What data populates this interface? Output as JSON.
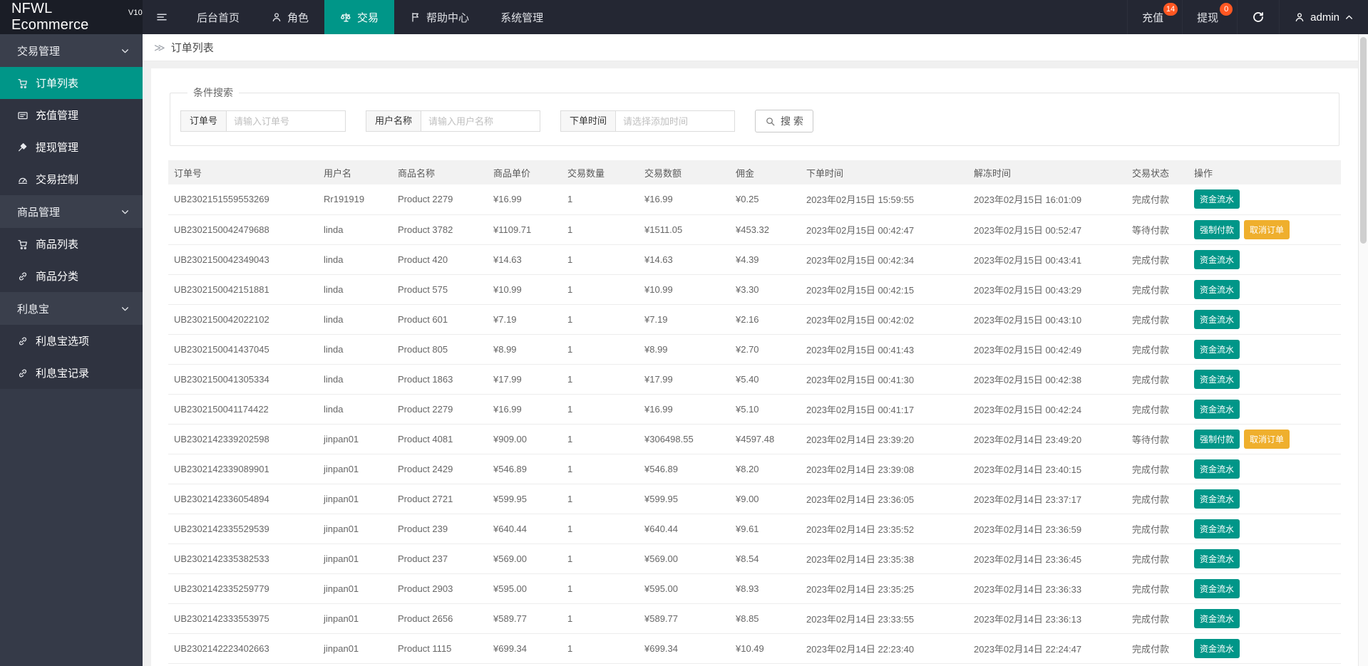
{
  "brand": {
    "name": "NFWL Ecommerce",
    "version": "V10"
  },
  "topnav": {
    "menu": [
      {
        "key": "dashboard",
        "label": "后台首页",
        "icon": "",
        "active": false
      },
      {
        "key": "roles",
        "label": "角色",
        "icon": "user",
        "active": false
      },
      {
        "key": "trade",
        "label": "交易",
        "icon": "scale",
        "active": true
      },
      {
        "key": "help-center",
        "label": "帮助中心",
        "icon": "flag",
        "active": false
      },
      {
        "key": "system",
        "label": "系统管理",
        "icon": "",
        "active": false
      }
    ],
    "quick": [
      {
        "key": "recharge",
        "label": "充值",
        "badge": "14"
      },
      {
        "key": "withdraw",
        "label": "提现",
        "badge": "0"
      }
    ],
    "user": {
      "name": "admin"
    }
  },
  "sidebar": {
    "groups": [
      {
        "key": "trade-management",
        "label": "交易管理",
        "items": [
          {
            "key": "order-list",
            "label": "订单列表",
            "icon": "cart",
            "active": true
          },
          {
            "key": "recharge-management",
            "label": "充值管理",
            "icon": "card",
            "active": false
          },
          {
            "key": "withdraw-management",
            "label": "提现管理",
            "icon": "gavel",
            "active": false
          },
          {
            "key": "trade-control",
            "label": "交易控制",
            "icon": "gauge",
            "active": false
          }
        ]
      },
      {
        "key": "product-management",
        "label": "商品管理",
        "items": [
          {
            "key": "product-list",
            "label": "商品列表",
            "icon": "cart",
            "active": false
          },
          {
            "key": "product-category",
            "label": "商品分类",
            "icon": "link",
            "active": false
          }
        ]
      },
      {
        "key": "interest-treasure",
        "label": "利息宝",
        "items": [
          {
            "key": "interest-options",
            "label": "利息宝选项",
            "icon": "link",
            "active": false
          },
          {
            "key": "interest-records",
            "label": "利息宝记录",
            "icon": "link",
            "active": false
          }
        ]
      }
    ]
  },
  "breadcrumb": {
    "title": "订单列表"
  },
  "search": {
    "legend": "条件搜索",
    "fields": [
      {
        "label": "订单号",
        "placeholder": "请输入订单号"
      },
      {
        "label": "用户名称",
        "placeholder": "请输入用户名称"
      },
      {
        "label": "下单时间",
        "placeholder": "请选择添加时间"
      }
    ],
    "button_label": "搜 索"
  },
  "table": {
    "headers": [
      "订单号",
      "用户名",
      "商品名称",
      "商品单价",
      "交易数量",
      "交易数额",
      "佣金",
      "下单时间",
      "解冻时间",
      "交易状态",
      "操作"
    ],
    "action_sets": {
      "flow": [
        {
          "label": "资金流水",
          "name": "fund-flow-button",
          "style": "teal"
        }
      ],
      "force": [
        {
          "label": "强制付款",
          "name": "force-pay-button",
          "style": "teal"
        },
        {
          "label": "取消订单",
          "name": "cancel-order-button",
          "style": "amber"
        }
      ]
    },
    "rows": [
      {
        "order_no": "UB2302151559553269",
        "username": "Rr191919",
        "product": "Product 2279",
        "price": "¥16.99",
        "qty": "1",
        "amount": "¥16.99",
        "commission": "¥0.25",
        "order_time": "2023年02月15日 15:59:55",
        "unfreeze_time": "2023年02月15日 16:01:09",
        "status": "完成付款",
        "actions": "flow"
      },
      {
        "order_no": "UB2302150042479688",
        "username": "linda",
        "product": "Product 3782",
        "price": "¥1109.71",
        "qty": "1",
        "amount": "¥1511.05",
        "commission": "¥453.32",
        "order_time": "2023年02月15日 00:42:47",
        "unfreeze_time": "2023年02月15日 00:52:47",
        "status": "等待付款",
        "actions": "force"
      },
      {
        "order_no": "UB2302150042349043",
        "username": "linda",
        "product": "Product 420",
        "price": "¥14.63",
        "qty": "1",
        "amount": "¥14.63",
        "commission": "¥4.39",
        "order_time": "2023年02月15日 00:42:34",
        "unfreeze_time": "2023年02月15日 00:43:41",
        "status": "完成付款",
        "actions": "flow"
      },
      {
        "order_no": "UB2302150042151881",
        "username": "linda",
        "product": "Product 575",
        "price": "¥10.99",
        "qty": "1",
        "amount": "¥10.99",
        "commission": "¥3.30",
        "order_time": "2023年02月15日 00:42:15",
        "unfreeze_time": "2023年02月15日 00:43:29",
        "status": "完成付款",
        "actions": "flow"
      },
      {
        "order_no": "UB2302150042022102",
        "username": "linda",
        "product": "Product 601",
        "price": "¥7.19",
        "qty": "1",
        "amount": "¥7.19",
        "commission": "¥2.16",
        "order_time": "2023年02月15日 00:42:02",
        "unfreeze_time": "2023年02月15日 00:43:10",
        "status": "完成付款",
        "actions": "flow"
      },
      {
        "order_no": "UB2302150041437045",
        "username": "linda",
        "product": "Product 805",
        "price": "¥8.99",
        "qty": "1",
        "amount": "¥8.99",
        "commission": "¥2.70",
        "order_time": "2023年02月15日 00:41:43",
        "unfreeze_time": "2023年02月15日 00:42:49",
        "status": "完成付款",
        "actions": "flow"
      },
      {
        "order_no": "UB2302150041305334",
        "username": "linda",
        "product": "Product 1863",
        "price": "¥17.99",
        "qty": "1",
        "amount": "¥17.99",
        "commission": "¥5.40",
        "order_time": "2023年02月15日 00:41:30",
        "unfreeze_time": "2023年02月15日 00:42:38",
        "status": "完成付款",
        "actions": "flow"
      },
      {
        "order_no": "UB2302150041174422",
        "username": "linda",
        "product": "Product 2279",
        "price": "¥16.99",
        "qty": "1",
        "amount": "¥16.99",
        "commission": "¥5.10",
        "order_time": "2023年02月15日 00:41:17",
        "unfreeze_time": "2023年02月15日 00:42:24",
        "status": "完成付款",
        "actions": "flow"
      },
      {
        "order_no": "UB2302142339202598",
        "username": "jinpan01",
        "product": "Product 4081",
        "price": "¥909.00",
        "qty": "1",
        "amount": "¥306498.55",
        "commission": "¥4597.48",
        "order_time": "2023年02月14日 23:39:20",
        "unfreeze_time": "2023年02月14日 23:49:20",
        "status": "等待付款",
        "actions": "force"
      },
      {
        "order_no": "UB2302142339089901",
        "username": "jinpan01",
        "product": "Product 2429",
        "price": "¥546.89",
        "qty": "1",
        "amount": "¥546.89",
        "commission": "¥8.20",
        "order_time": "2023年02月14日 23:39:08",
        "unfreeze_time": "2023年02月14日 23:40:15",
        "status": "完成付款",
        "actions": "flow"
      },
      {
        "order_no": "UB2302142336054894",
        "username": "jinpan01",
        "product": "Product 2721",
        "price": "¥599.95",
        "qty": "1",
        "amount": "¥599.95",
        "commission": "¥9.00",
        "order_time": "2023年02月14日 23:36:05",
        "unfreeze_time": "2023年02月14日 23:37:17",
        "status": "完成付款",
        "actions": "flow"
      },
      {
        "order_no": "UB2302142335529539",
        "username": "jinpan01",
        "product": "Product 239",
        "price": "¥640.44",
        "qty": "1",
        "amount": "¥640.44",
        "commission": "¥9.61",
        "order_time": "2023年02月14日 23:35:52",
        "unfreeze_time": "2023年02月14日 23:36:59",
        "status": "完成付款",
        "actions": "flow"
      },
      {
        "order_no": "UB2302142335382533",
        "username": "jinpan01",
        "product": "Product 237",
        "price": "¥569.00",
        "qty": "1",
        "amount": "¥569.00",
        "commission": "¥8.54",
        "order_time": "2023年02月14日 23:35:38",
        "unfreeze_time": "2023年02月14日 23:36:45",
        "status": "完成付款",
        "actions": "flow"
      },
      {
        "order_no": "UB2302142335259779",
        "username": "jinpan01",
        "product": "Product 2903",
        "price": "¥595.00",
        "qty": "1",
        "amount": "¥595.00",
        "commission": "¥8.93",
        "order_time": "2023年02月14日 23:35:25",
        "unfreeze_time": "2023年02月14日 23:36:33",
        "status": "完成付款",
        "actions": "flow"
      },
      {
        "order_no": "UB2302142333553975",
        "username": "jinpan01",
        "product": "Product 2656",
        "price": "¥589.77",
        "qty": "1",
        "amount": "¥589.77",
        "commission": "¥8.85",
        "order_time": "2023年02月14日 23:33:55",
        "unfreeze_time": "2023年02月14日 23:36:13",
        "status": "完成付款",
        "actions": "flow"
      },
      {
        "order_no": "UB2302142223402663",
        "username": "jinpan01",
        "product": "Product 1115",
        "price": "¥699.34",
        "qty": "1",
        "amount": "¥699.34",
        "commission": "¥10.49",
        "order_time": "2023年02月14日 22:23:40",
        "unfreeze_time": "2023年02月14日 22:24:47",
        "status": "完成付款",
        "actions": "flow"
      }
    ]
  },
  "colors": {
    "accent": "#009688",
    "badge": "#ff5722",
    "cancel_button": "#efaf2d",
    "navbar": "#242733",
    "sidebar": "#2f3340"
  }
}
